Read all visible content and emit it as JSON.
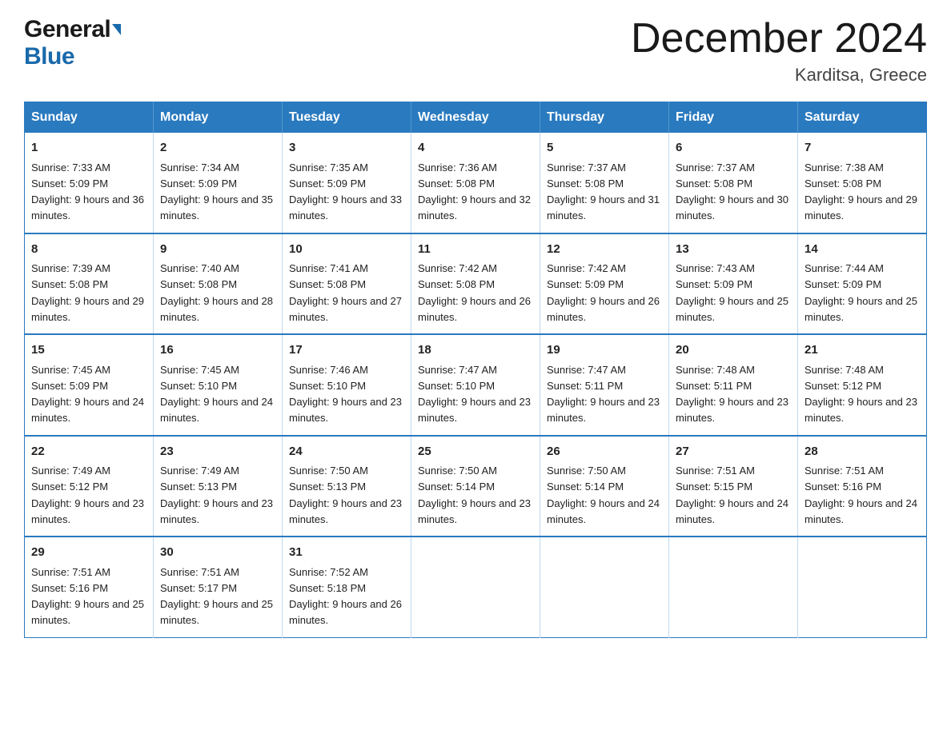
{
  "header": {
    "logo_general": "General",
    "logo_blue": "Blue",
    "month": "December 2024",
    "location": "Karditsa, Greece"
  },
  "days_header": [
    "Sunday",
    "Monday",
    "Tuesday",
    "Wednesday",
    "Thursday",
    "Friday",
    "Saturday"
  ],
  "weeks": [
    [
      {
        "num": "1",
        "sunrise": "7:33 AM",
        "sunset": "5:09 PM",
        "daylight": "9 hours and 36 minutes."
      },
      {
        "num": "2",
        "sunrise": "7:34 AM",
        "sunset": "5:09 PM",
        "daylight": "9 hours and 35 minutes."
      },
      {
        "num": "3",
        "sunrise": "7:35 AM",
        "sunset": "5:09 PM",
        "daylight": "9 hours and 33 minutes."
      },
      {
        "num": "4",
        "sunrise": "7:36 AM",
        "sunset": "5:08 PM",
        "daylight": "9 hours and 32 minutes."
      },
      {
        "num": "5",
        "sunrise": "7:37 AM",
        "sunset": "5:08 PM",
        "daylight": "9 hours and 31 minutes."
      },
      {
        "num": "6",
        "sunrise": "7:37 AM",
        "sunset": "5:08 PM",
        "daylight": "9 hours and 30 minutes."
      },
      {
        "num": "7",
        "sunrise": "7:38 AM",
        "sunset": "5:08 PM",
        "daylight": "9 hours and 29 minutes."
      }
    ],
    [
      {
        "num": "8",
        "sunrise": "7:39 AM",
        "sunset": "5:08 PM",
        "daylight": "9 hours and 29 minutes."
      },
      {
        "num": "9",
        "sunrise": "7:40 AM",
        "sunset": "5:08 PM",
        "daylight": "9 hours and 28 minutes."
      },
      {
        "num": "10",
        "sunrise": "7:41 AM",
        "sunset": "5:08 PM",
        "daylight": "9 hours and 27 minutes."
      },
      {
        "num": "11",
        "sunrise": "7:42 AM",
        "sunset": "5:08 PM",
        "daylight": "9 hours and 26 minutes."
      },
      {
        "num": "12",
        "sunrise": "7:42 AM",
        "sunset": "5:09 PM",
        "daylight": "9 hours and 26 minutes."
      },
      {
        "num": "13",
        "sunrise": "7:43 AM",
        "sunset": "5:09 PM",
        "daylight": "9 hours and 25 minutes."
      },
      {
        "num": "14",
        "sunrise": "7:44 AM",
        "sunset": "5:09 PM",
        "daylight": "9 hours and 25 minutes."
      }
    ],
    [
      {
        "num": "15",
        "sunrise": "7:45 AM",
        "sunset": "5:09 PM",
        "daylight": "9 hours and 24 minutes."
      },
      {
        "num": "16",
        "sunrise": "7:45 AM",
        "sunset": "5:10 PM",
        "daylight": "9 hours and 24 minutes."
      },
      {
        "num": "17",
        "sunrise": "7:46 AM",
        "sunset": "5:10 PM",
        "daylight": "9 hours and 23 minutes."
      },
      {
        "num": "18",
        "sunrise": "7:47 AM",
        "sunset": "5:10 PM",
        "daylight": "9 hours and 23 minutes."
      },
      {
        "num": "19",
        "sunrise": "7:47 AM",
        "sunset": "5:11 PM",
        "daylight": "9 hours and 23 minutes."
      },
      {
        "num": "20",
        "sunrise": "7:48 AM",
        "sunset": "5:11 PM",
        "daylight": "9 hours and 23 minutes."
      },
      {
        "num": "21",
        "sunrise": "7:48 AM",
        "sunset": "5:12 PM",
        "daylight": "9 hours and 23 minutes."
      }
    ],
    [
      {
        "num": "22",
        "sunrise": "7:49 AM",
        "sunset": "5:12 PM",
        "daylight": "9 hours and 23 minutes."
      },
      {
        "num": "23",
        "sunrise": "7:49 AM",
        "sunset": "5:13 PM",
        "daylight": "9 hours and 23 minutes."
      },
      {
        "num": "24",
        "sunrise": "7:50 AM",
        "sunset": "5:13 PM",
        "daylight": "9 hours and 23 minutes."
      },
      {
        "num": "25",
        "sunrise": "7:50 AM",
        "sunset": "5:14 PM",
        "daylight": "9 hours and 23 minutes."
      },
      {
        "num": "26",
        "sunrise": "7:50 AM",
        "sunset": "5:14 PM",
        "daylight": "9 hours and 24 minutes."
      },
      {
        "num": "27",
        "sunrise": "7:51 AM",
        "sunset": "5:15 PM",
        "daylight": "9 hours and 24 minutes."
      },
      {
        "num": "28",
        "sunrise": "7:51 AM",
        "sunset": "5:16 PM",
        "daylight": "9 hours and 24 minutes."
      }
    ],
    [
      {
        "num": "29",
        "sunrise": "7:51 AM",
        "sunset": "5:16 PM",
        "daylight": "9 hours and 25 minutes."
      },
      {
        "num": "30",
        "sunrise": "7:51 AM",
        "sunset": "5:17 PM",
        "daylight": "9 hours and 25 minutes."
      },
      {
        "num": "31",
        "sunrise": "7:52 AM",
        "sunset": "5:18 PM",
        "daylight": "9 hours and 26 minutes."
      },
      null,
      null,
      null,
      null
    ]
  ]
}
